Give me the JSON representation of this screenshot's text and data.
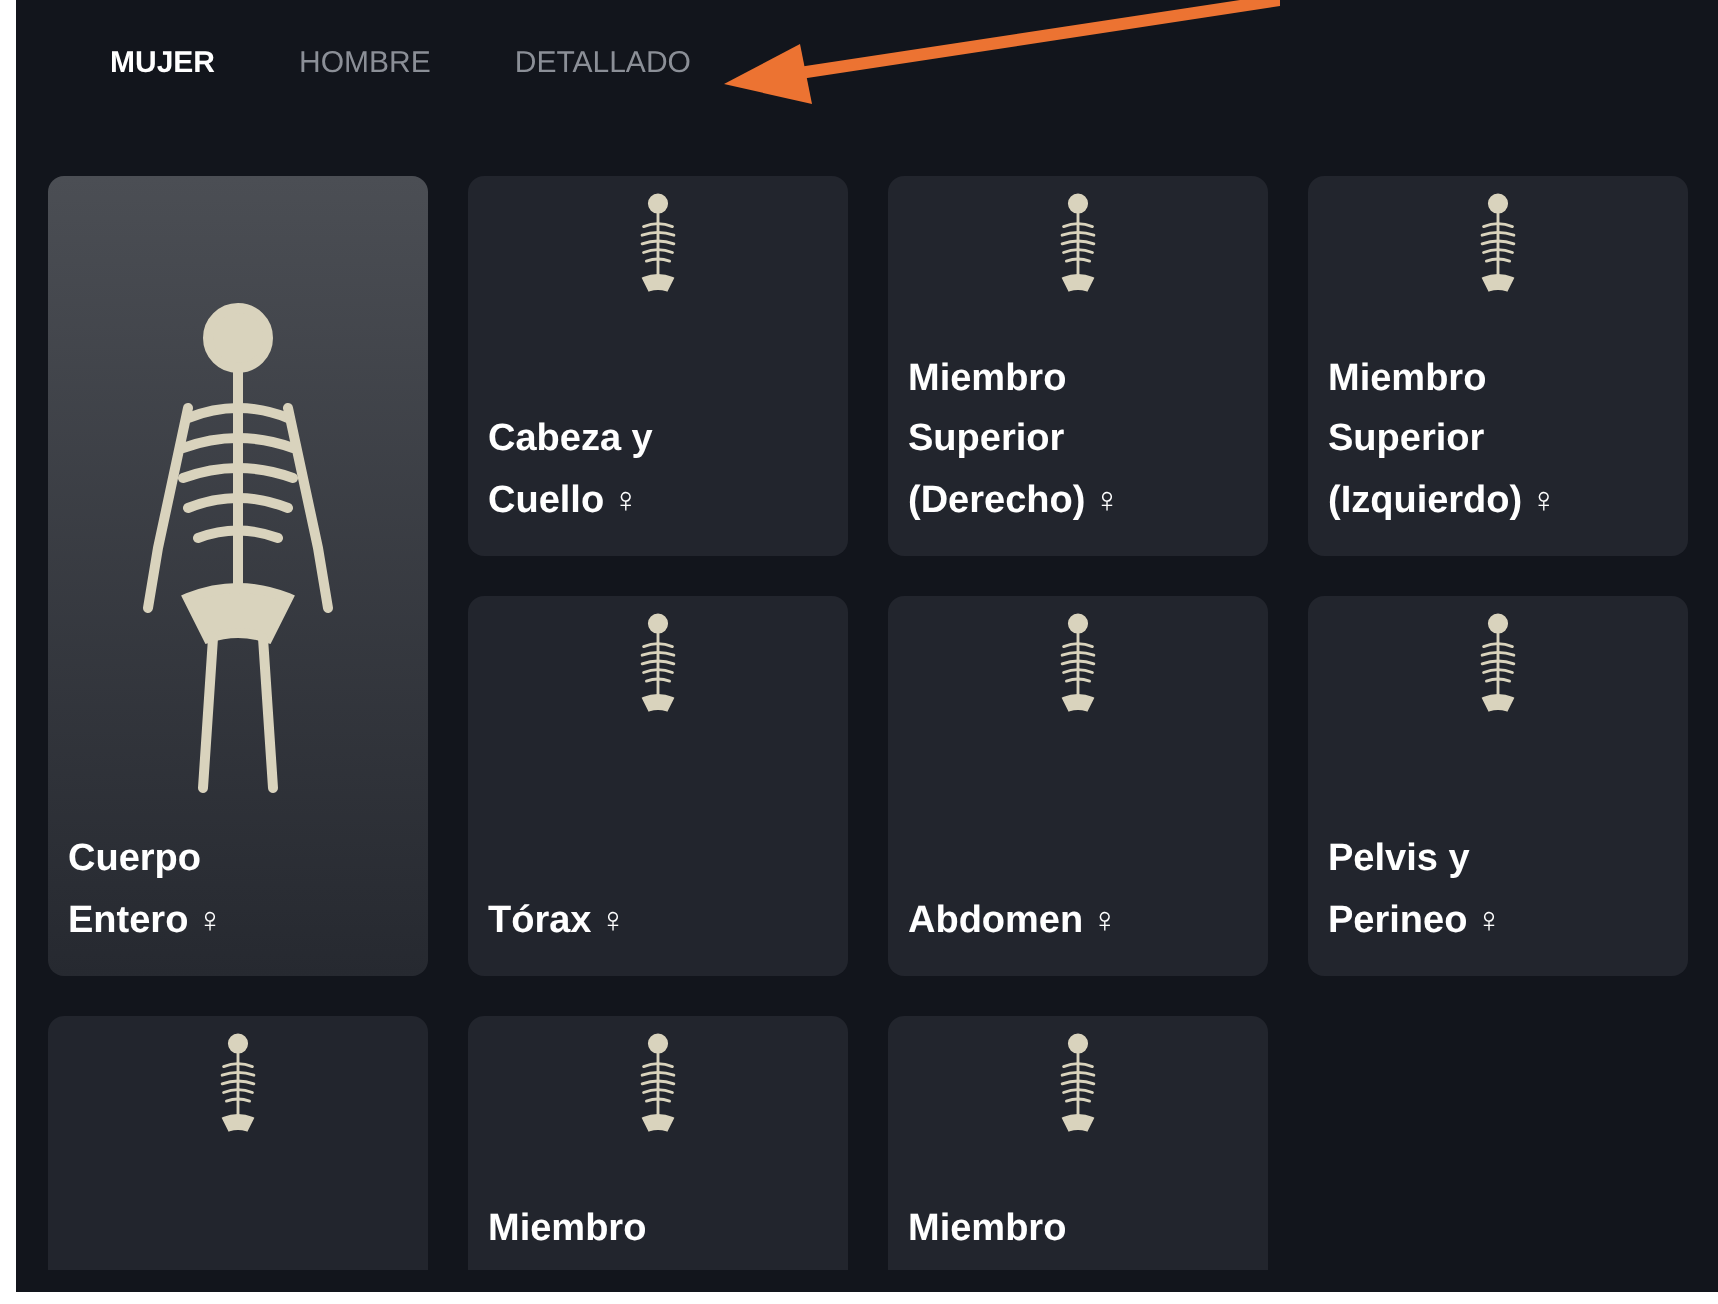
{
  "tabs": [
    {
      "label": "MUJER",
      "selected": true
    },
    {
      "label": "HOMBRE",
      "selected": false
    },
    {
      "label": "DETALLADO",
      "selected": false
    }
  ],
  "cards": [
    {
      "title": "Cuerpo Entero",
      "symbol": "♀",
      "selected": true,
      "tall": true
    },
    {
      "title": "Cabeza y Cuello",
      "symbol": "♀",
      "selected": false,
      "tall": false
    },
    {
      "title": "Miembro Superior (Derecho)",
      "symbol": "♀",
      "selected": false,
      "tall": false
    },
    {
      "title": "Miembro Superior (Izquierdo)",
      "symbol": "♀",
      "selected": false,
      "tall": false
    },
    {
      "title": "Tórax",
      "symbol": "♀",
      "selected": false,
      "tall": false
    },
    {
      "title": "Abdomen",
      "symbol": "♀",
      "selected": false,
      "tall": false
    },
    {
      "title": "Pelvis y Perineo",
      "symbol": "♀",
      "selected": false,
      "tall": false
    },
    {
      "selected": false,
      "tall": false
    },
    {
      "title": "Miembro",
      "selected": false,
      "tall": false
    },
    {
      "title": "Miembro",
      "selected": false,
      "tall": false
    }
  ]
}
